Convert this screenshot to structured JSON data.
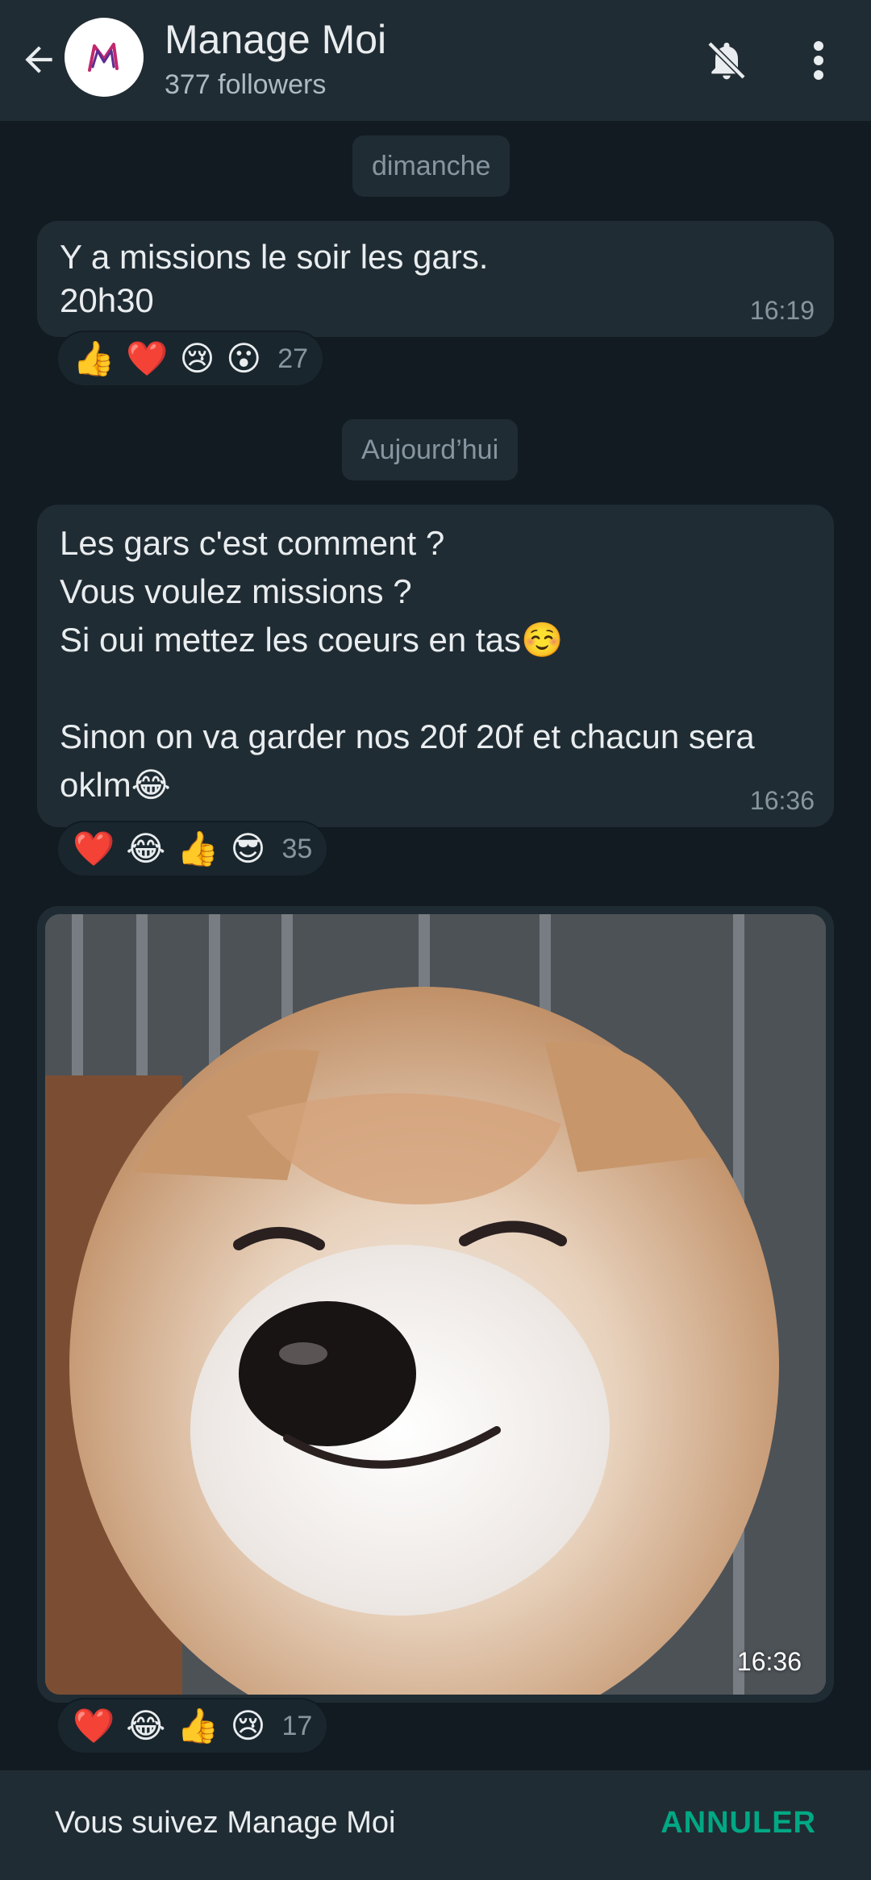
{
  "header": {
    "title": "Manage Moi",
    "subtitle": "377 followers",
    "icons": [
      "back-arrow-icon",
      "bell-muted-icon",
      "more-vert-icon"
    ]
  },
  "chips": {
    "day1": "dimanche",
    "day2": "Aujourd’hui"
  },
  "messages": [
    {
      "text": "Y a missions le soir les gars.\n20h30",
      "time": "16:19",
      "reactions": [
        "👍",
        "❤️",
        "😢",
        "😮"
      ],
      "reaction_count": "27"
    },
    {
      "text": "Les gars c'est comment ?\nVous voulez missions ?\nSi oui mettez les coeurs en tas☺️\n\nSinon on va garder nos 20f 20f et chacun sera oklm😂",
      "time": "16:36",
      "reactions": [
        "❤️",
        "😂",
        "👍",
        "😎"
      ],
      "reaction_count": "35"
    },
    {
      "time": "16:36",
      "reactions": [
        "❤️",
        "😂",
        "👍",
        "😢"
      ],
      "reaction_count": "17"
    }
  ],
  "footer": {
    "text": "Vous suivez Manage Moi",
    "action": "ANNULER"
  },
  "colors": {
    "background": "#111b21",
    "bar": "#202c33",
    "bubble": "#202c33",
    "accent": "#00a884",
    "muted_text": "#8696a0"
  }
}
